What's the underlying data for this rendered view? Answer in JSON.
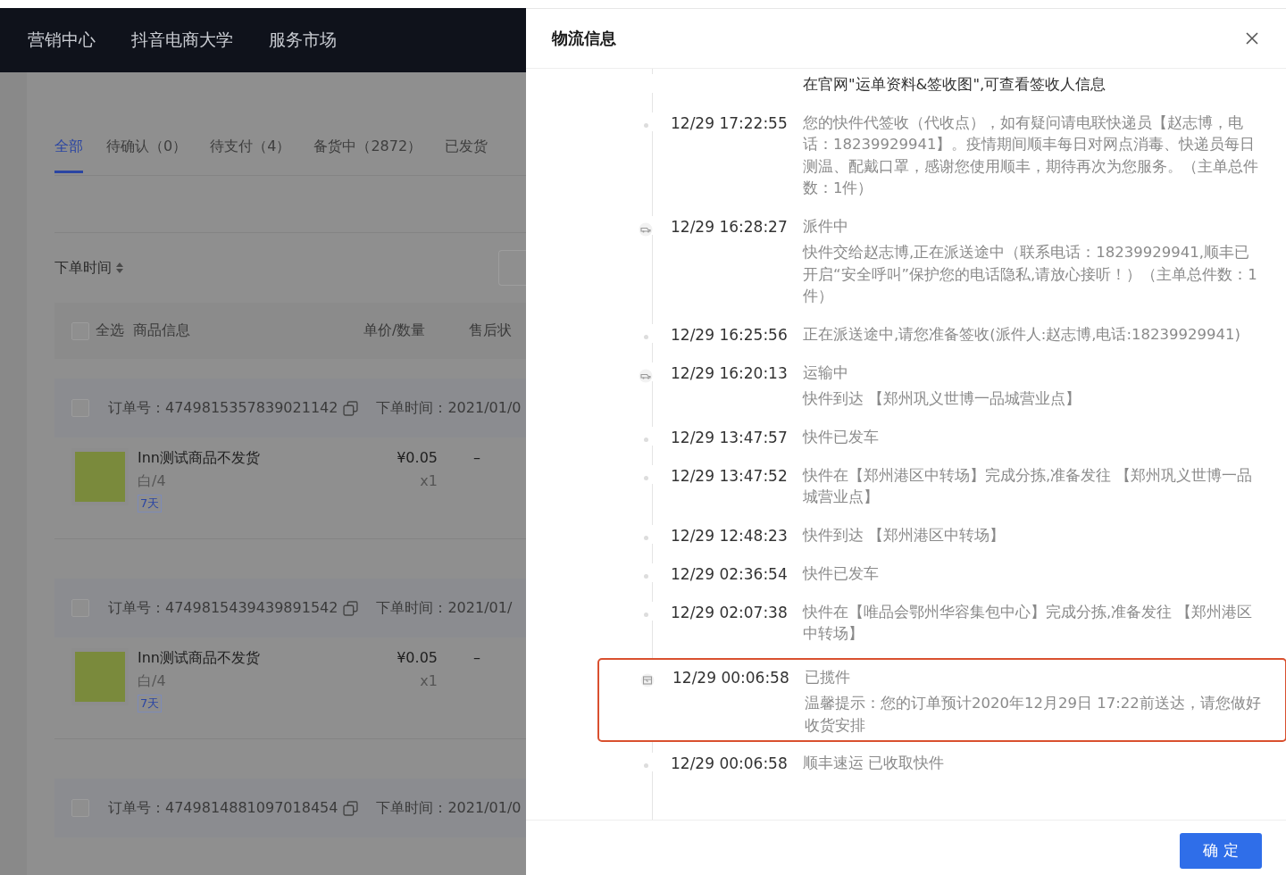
{
  "top_nav": {
    "items": [
      "营销中心",
      "抖音电商大学",
      "服务市场"
    ]
  },
  "order_tabs": [
    {
      "label": "全部",
      "selected": true
    },
    {
      "label": "待确认（0）",
      "selected": false
    },
    {
      "label": "待支付（4）",
      "selected": false
    },
    {
      "label": "备货中（2872）",
      "selected": false
    },
    {
      "label": "已发货",
      "selected": false
    }
  ],
  "sort": {
    "label": "下单时间"
  },
  "table_header": {
    "checked": false,
    "select_all": "全选",
    "columns": [
      "商品信息",
      "单价/数量",
      "售后状"
    ]
  },
  "orders": [
    {
      "checked": false,
      "order_no": "订单号：4749815357839021142",
      "order_time": "下单时间：2021/01/0",
      "product": {
        "name": "Inn测试商品不发货",
        "spec": "白/4",
        "tag": "7天",
        "price": "¥0.05",
        "qty": "x1",
        "after_sale": "–"
      }
    },
    {
      "checked": false,
      "order_no": "订单号：4749815439439891542",
      "order_time": "下单时间：2021/01/",
      "product": {
        "name": "Inn测试商品不发货",
        "spec": "白/4",
        "tag": "7天",
        "price": "¥0.05",
        "qty": "x1",
        "after_sale": "–"
      }
    },
    {
      "checked": false,
      "order_no": "订单号：4749814881097018454",
      "order_time": "下单时间：2021/01/0"
    }
  ],
  "drawer": {
    "title": "物流信息",
    "confirm_button": "确 定",
    "events": [
      {
        "kind": "continued",
        "detail": "在官网\"运单资料&签收图\",可查看签收人信息",
        "highlighted": false
      },
      {
        "kind": "dot",
        "time": "12/29 17:22:55",
        "detail": "您的快件代签收（代收点），如有疑问请电联快递员【赵志博，电话：18239929941】。疫情期间顺丰每日对网点消毒、快递员每日测温、配戴口罩，感谢您使用顺丰，期待再次为您服务。（主单总件数：1件）",
        "highlighted": false
      },
      {
        "kind": "vehicle",
        "time": "12/29 16:28:27",
        "status": "派件中",
        "detail": "快件交给赵志博,正在派送途中（联系电话：18239929941,顺丰已开启“安全呼叫”保护您的电话隐私,请放心接听！）（主单总件数：1件）",
        "highlighted": false
      },
      {
        "kind": "dot",
        "time": "12/29 16:25:56",
        "detail": "正在派送途中,请您准备签收(派件人:赵志博,电话:18239929941)",
        "highlighted": false
      },
      {
        "kind": "vehicle",
        "time": "12/29 16:20:13",
        "status": "运输中",
        "detail": "快件到达 【郑州巩义世博一品城营业点】",
        "highlighted": false
      },
      {
        "kind": "dot",
        "time": "12/29 13:47:57",
        "detail": "快件已发车",
        "highlighted": false
      },
      {
        "kind": "dot",
        "time": "12/29 13:47:52",
        "detail": "快件在【郑州港区中转场】完成分拣,准备发往 【郑州巩义世博一品城营业点】",
        "highlighted": false
      },
      {
        "kind": "dot",
        "time": "12/29 12:48:23",
        "detail": "快件到达 【郑州港区中转场】",
        "highlighted": false
      },
      {
        "kind": "dot",
        "time": "12/29 02:36:54",
        "detail": "快件已发车",
        "highlighted": false
      },
      {
        "kind": "dot",
        "time": "12/29 02:07:38",
        "detail": "快件在【唯品会鄂州华容集包中心】完成分拣,准备发往 【郑州港区中转场】",
        "highlighted": false
      },
      {
        "kind": "parcel",
        "time": "12/29 00:06:58",
        "status": "已揽件",
        "detail": "温馨提示：您的订单预计2020年12月29日 17:22前送达，请您做好收货安排",
        "highlighted": true
      },
      {
        "kind": "dot",
        "time": "12/29 00:06:58",
        "detail": "顺丰速运 已收取快件",
        "highlighted": false
      }
    ]
  }
}
